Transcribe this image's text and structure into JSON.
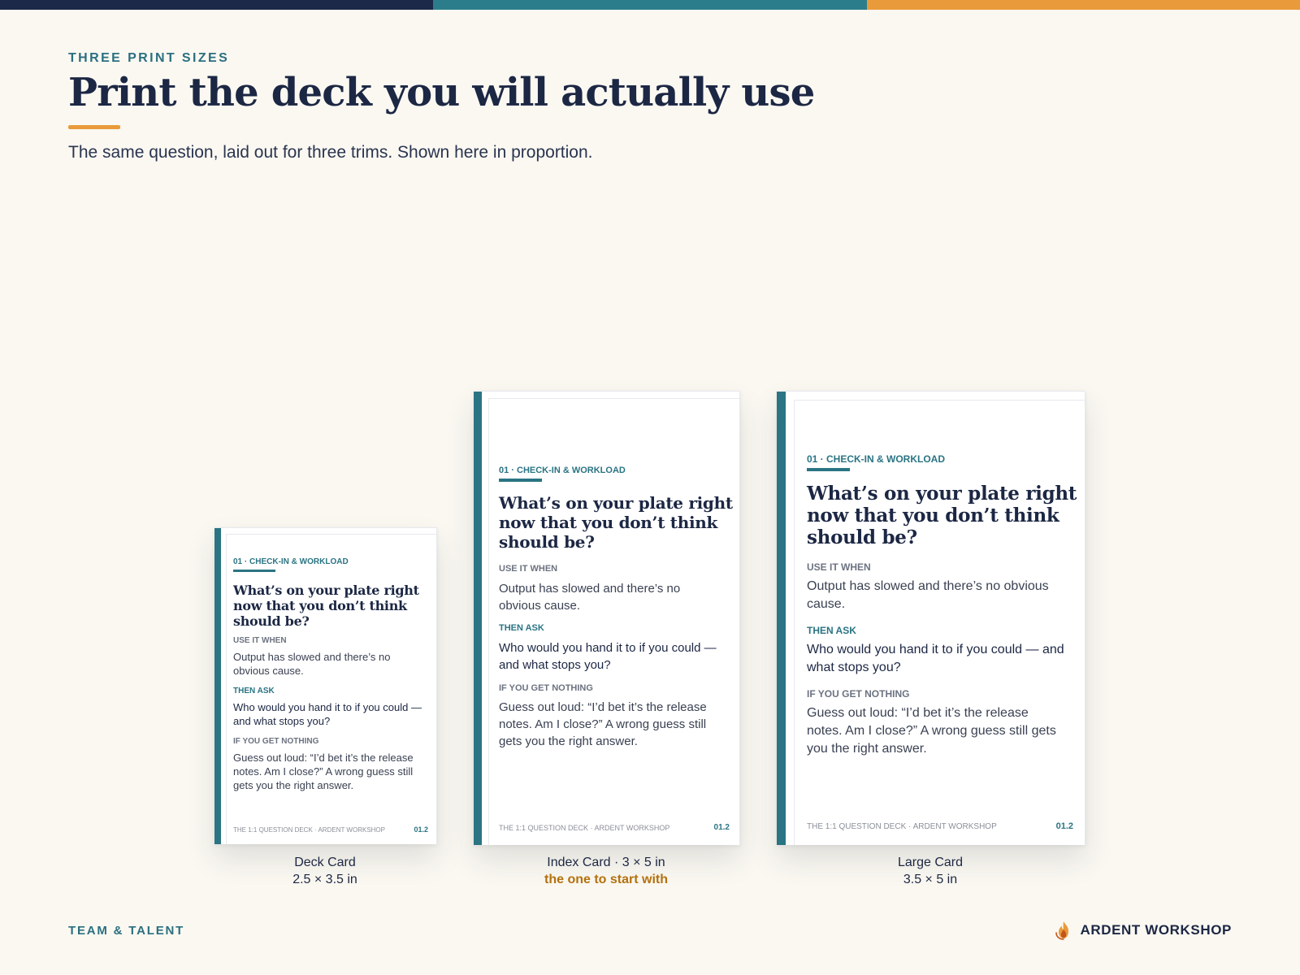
{
  "palette": {
    "navy": "#1d2948",
    "teal": "#2c7d8c",
    "orange": "#e99a3a",
    "background": "#faf8f1",
    "note_gold": "#b4710f"
  },
  "header": {
    "eyebrow": "THREE PRINT SIZES",
    "title": "Print the deck you will actually use",
    "subtitle": "The same question, laid out for three trims. Shown here in proportion."
  },
  "card_content": {
    "category": "01 · CHECK-IN & WORKLOAD",
    "question": "What’s on your plate right now that you don’t think should be?",
    "use_it_when_label": "USE IT WHEN",
    "use_it_when": "Output has slowed and there’s no obvious cause.",
    "then_ask_label": "THEN ASK",
    "then_ask": "Who would you hand it to if you could — and what stops you?",
    "if_nothing_label": "IF YOU GET NOTHING",
    "if_nothing": "Guess out loud: “I’d bet it’s the release notes. Am I close?” A wrong guess still gets you the right answer.",
    "footer": "THE 1:1 QUESTION DECK · ARDENT WORKSHOP",
    "number": "01.2"
  },
  "cards": [
    {
      "name": "Deck Card",
      "size": "2.5 × 3.5 in",
      "note": ""
    },
    {
      "name": "Index Card · 3 × 5 in",
      "size": "",
      "note": "the one to start with"
    },
    {
      "name": "Large Card",
      "size": "3.5 × 5 in",
      "note": ""
    }
  ],
  "footer": {
    "section": "TEAM & TALENT",
    "brand": "ARDENT WORKSHOP",
    "brand_icon": "flame-icon"
  }
}
